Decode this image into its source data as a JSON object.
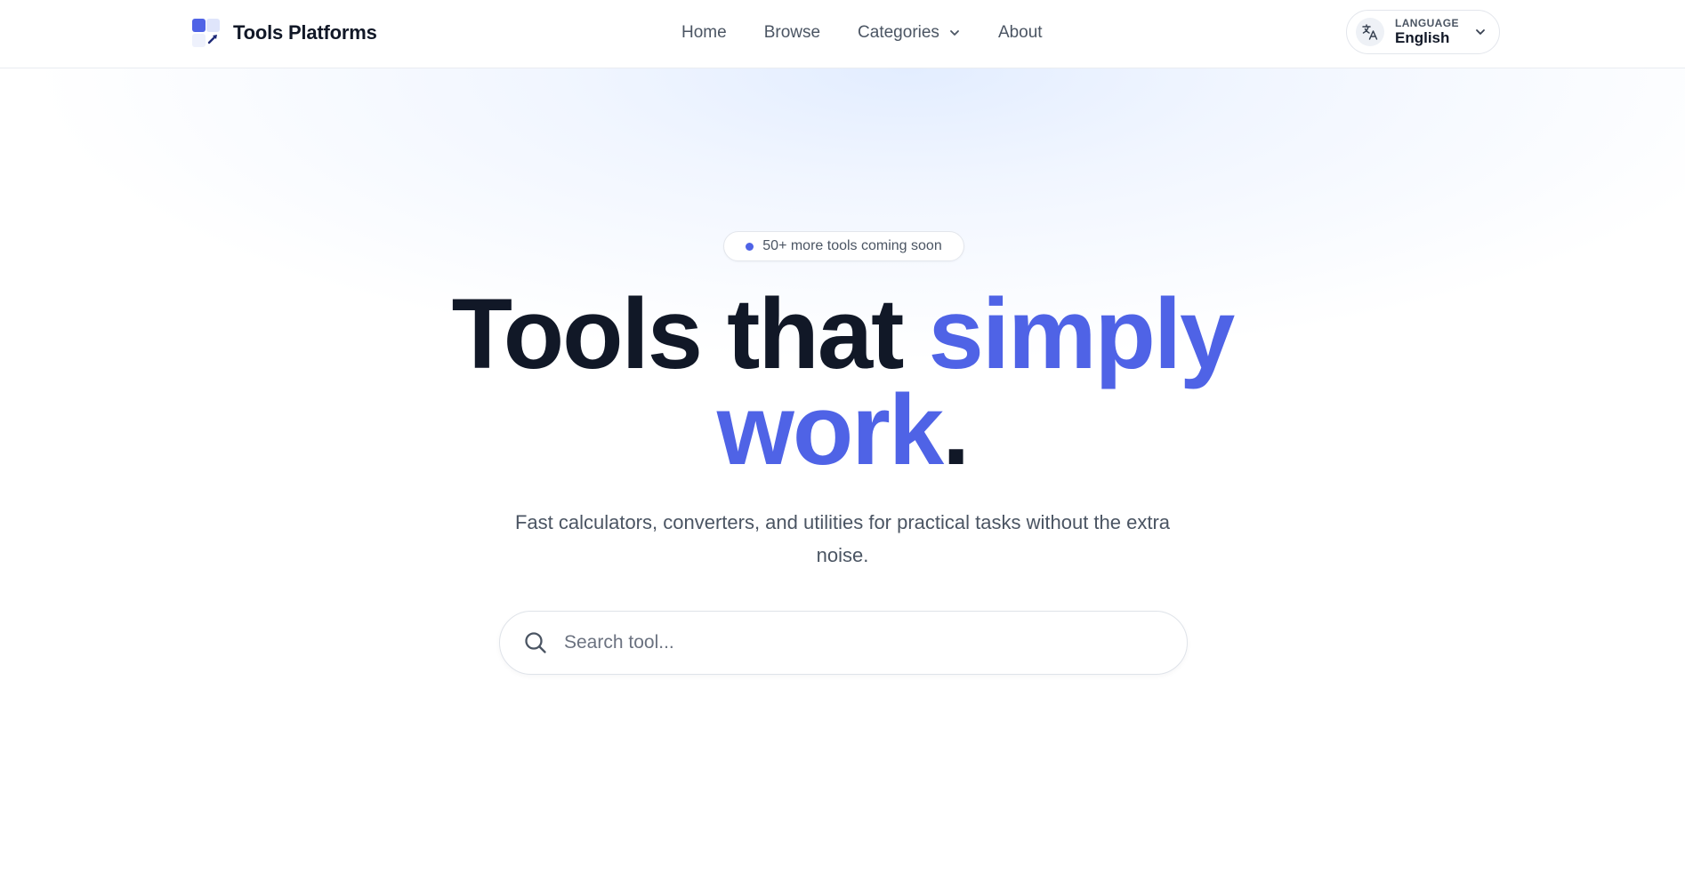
{
  "header": {
    "brand": "Tools Platforms",
    "nav": {
      "home": "Home",
      "browse": "Browse",
      "categories": "Categories",
      "about": "About"
    },
    "language": {
      "caption": "LANGUAGE",
      "value": "English"
    }
  },
  "hero": {
    "badge": "50+ more tools coming soon",
    "headline": {
      "part1": "Tools that ",
      "accent1": "simply",
      "accent2": "work",
      "end": "."
    },
    "subtitle": "Fast calculators, converters, and utilities for practical tasks without the extra noise.",
    "search": {
      "placeholder": "Search tool...",
      "value": ""
    }
  },
  "colors": {
    "accent": "#4f63e6",
    "text": "#111827",
    "muted": "#4b5563"
  },
  "icons": {
    "brand": "tools-logo-icon",
    "language": "translate-icon",
    "dropdown": "chevron-down-icon",
    "search": "search-icon",
    "badge": "status-dot"
  }
}
